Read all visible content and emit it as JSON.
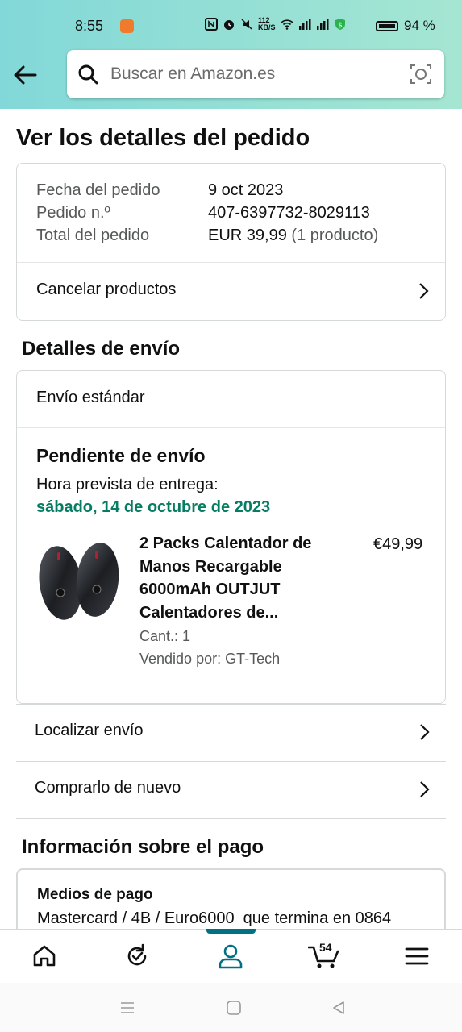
{
  "status_bar": {
    "time": "8:55",
    "speed_top": "112",
    "speed_unit": "KB/S",
    "battery": "94 %"
  },
  "search": {
    "placeholder": "Buscar en Amazon.es"
  },
  "page_title": "Ver los detalles del pedido",
  "order": {
    "date_label": "Fecha del pedido",
    "date_value": "9 oct 2023",
    "number_label": "Pedido n.º",
    "number_value": "407-6397732-8029113",
    "total_label": "Total del pedido",
    "total_value": "EUR 39,99",
    "total_count": "(1 producto)",
    "cancel_label": "Cancelar productos"
  },
  "shipping": {
    "section_title": "Detalles de envío",
    "method": "Envío estándar",
    "status": "Pendiente de envío",
    "eta_label": "Hora prevista de entrega:",
    "eta_date": "sábado, 14 de octubre de 2023",
    "product": {
      "title_lines": [
        "2 Packs Calentador de",
        "Manos Recargable",
        "6000mAh OUTJUT",
        "Calentadores de..."
      ],
      "price": "€49,99",
      "quantity": "Cant.: 1",
      "seller": "Vendido por: GT-Tech"
    },
    "track_label": "Localizar envío",
    "buy_again_label": "Comprarlo de nuevo"
  },
  "payment": {
    "section_title": "Información sobre el pago",
    "methods_label": "Medios de pago",
    "methods_value": "Mastercard / 4B / Euro6000  que termina en 0864"
  },
  "bottom_nav": {
    "cart_count": "54",
    "items": [
      "home-icon",
      "refresh-icon",
      "account-icon",
      "cart-icon",
      "menu-icon"
    ]
  },
  "colors": {
    "accent": "#007185",
    "eta_green": "#067D62",
    "header_start": "#82d8d8",
    "header_end": "#a5e6d2"
  }
}
